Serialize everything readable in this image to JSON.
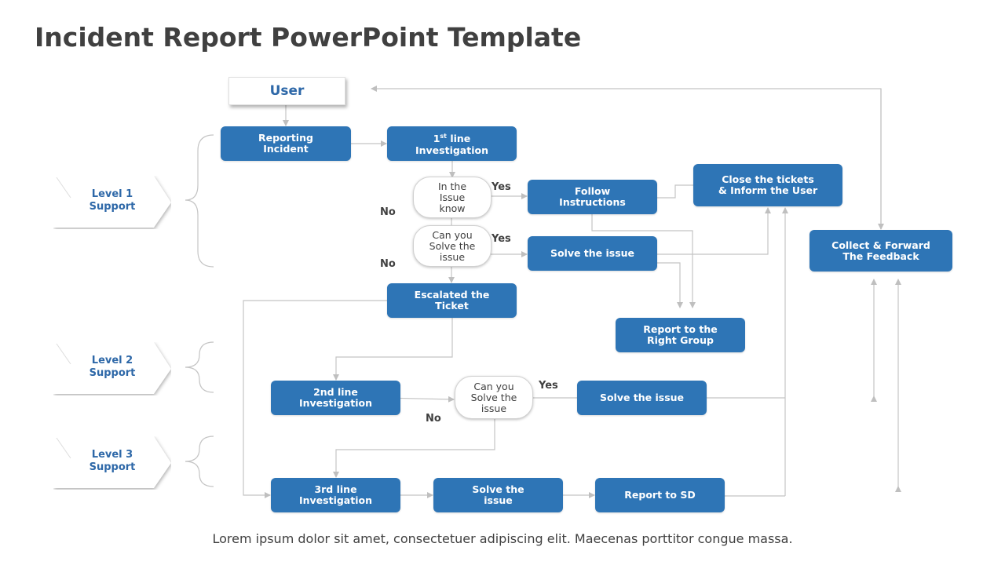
{
  "title": "Incident Report PowerPoint Template",
  "footer": "Lorem ipsum dolor sit amet, consectetuer adipiscing elit. Maecenas porttitor congue massa.",
  "colors": {
    "box": "#2e75b6",
    "level_text": "#2e68a8",
    "connector": "#bfbfbf",
    "title": "#404040"
  },
  "levels": [
    {
      "label": "Level 1\nSupport"
    },
    {
      "label": "Level 2\nSupport"
    },
    {
      "label": "Level 3\nSupport"
    }
  ],
  "user": "User",
  "boxes": {
    "reporting": "Reporting\nIncident",
    "first_line_prefix": "1",
    "first_line_sup": "st",
    "first_line_rest": " line",
    "first_line_second": "Investigation",
    "follow": "Follow\nInstructions",
    "close": "Close the tickets\n& Inform the User",
    "solve1": "Solve the issue",
    "collect": "Collect & Forward\nThe Feedback",
    "escalated": "Escalated the\nTicket",
    "report_group": "Report to the\nRight Group",
    "second_line": "2nd line\nInvestigation",
    "solve2": "Solve the issue",
    "third_line": "3rd line\nInvestigation",
    "solve3": "Solve the\nissue",
    "report_sd": "Report to SD"
  },
  "decisions": {
    "know": "In the\nIssue\nknow",
    "can_solve1": "Can you\nSolve the\nissue",
    "can_solve2": "Can you\nSolve the\nissue"
  },
  "labels": {
    "yes1": "Yes",
    "no1": "No",
    "yes2": "Yes",
    "no2": "No",
    "yes3": "Yes",
    "no3": "No"
  }
}
